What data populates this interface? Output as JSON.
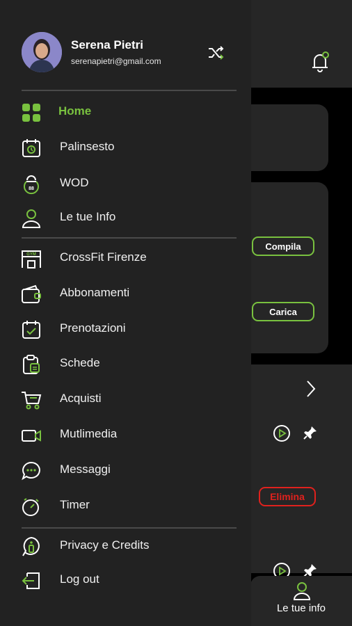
{
  "user": {
    "name": "Serena Pietri",
    "email": "serenapietri@gmail.com"
  },
  "menu": {
    "group1": [
      {
        "label": "Home",
        "icon": "grid-icon",
        "active": true
      },
      {
        "label": "Palinsesto",
        "icon": "calendar-icon"
      },
      {
        "label": "WOD",
        "icon": "kettlebell-icon"
      },
      {
        "label": "Le tue Info",
        "icon": "user-icon"
      }
    ],
    "group2": [
      {
        "label": "CrossFit Firenze",
        "icon": "gym-icon"
      },
      {
        "label": "Abbonamenti",
        "icon": "wallet-icon"
      },
      {
        "label": "Prenotazioni",
        "icon": "calendar-check-icon"
      },
      {
        "label": "Schede",
        "icon": "clipboard-icon"
      },
      {
        "label": "Acquisti",
        "icon": "cart-icon"
      },
      {
        "label": "Mutlimedia",
        "icon": "video-camera-icon"
      },
      {
        "label": "Messaggi",
        "icon": "chat-icon"
      },
      {
        "label": "Timer",
        "icon": "stopwatch-icon"
      }
    ],
    "group3": [
      {
        "label": "Privacy e Credits",
        "icon": "info-icon"
      },
      {
        "label": "Log out",
        "icon": "logout-icon"
      }
    ]
  },
  "background": {
    "compila_label": "Compila",
    "carica_label": "Carica",
    "elimina_label": "Elimina",
    "bottom_tab_label": "Le tue info"
  },
  "colors": {
    "accent": "#79c13f",
    "danger": "#e0211d",
    "drawer_bg": "#222222",
    "page_bg": "#000000"
  }
}
